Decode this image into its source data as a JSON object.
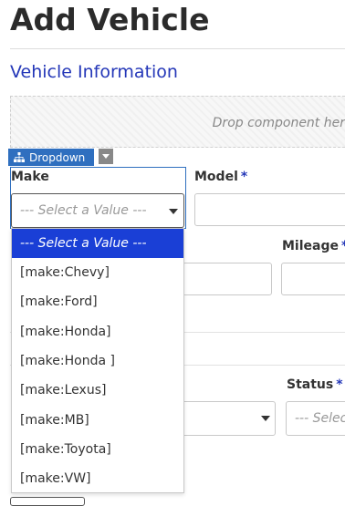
{
  "page_title": "Add Vehicle",
  "section_title": "Vehicle Information",
  "dropzone_text": "Drop component her",
  "component_tag": {
    "icon": "sitemap-icon",
    "label": "Dropdown"
  },
  "make": {
    "label": "Make",
    "placeholder": "--- Select a Value ---",
    "options": [
      "--- Select a Value ---",
      "[make:Chevy]",
      "[make:Ford]",
      "[make:Honda]",
      "[make:Honda ]",
      "[make:Lexus]",
      "[make:MB]",
      "[make:Toyota]",
      "[make:VW]"
    ]
  },
  "model": {
    "label": "Model",
    "required": "*"
  },
  "mileage": {
    "label": "Mileage",
    "required": "*"
  },
  "status": {
    "label": "Status",
    "required": "*",
    "placeholder": "--- Selec"
  },
  "colors": {
    "accent": "#2437b8",
    "selected_option": "#1a3fd6",
    "tag": "#2f6fbf"
  }
}
